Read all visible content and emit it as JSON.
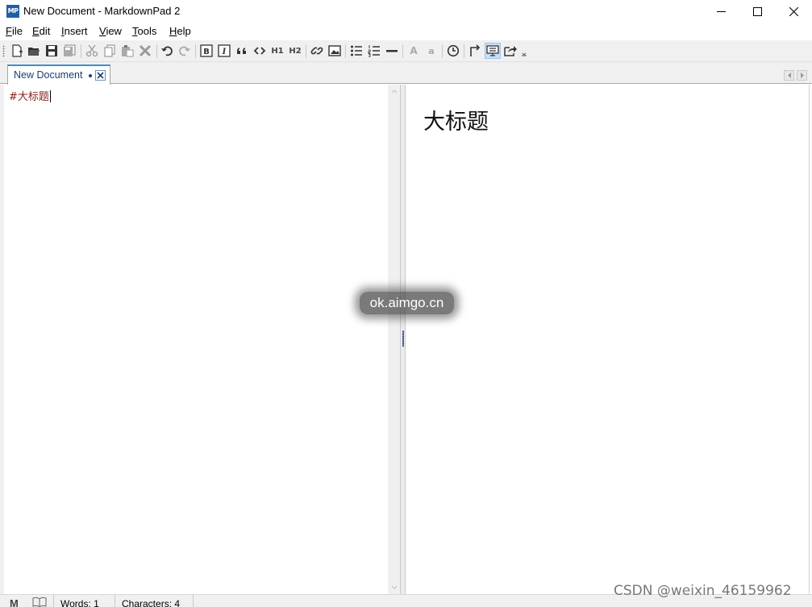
{
  "window": {
    "title": "New Document - MarkdownPad 2",
    "app_icon_text": "MP"
  },
  "menu": [
    {
      "label": "File"
    },
    {
      "label": "Edit"
    },
    {
      "label": "Insert"
    },
    {
      "label": "View"
    },
    {
      "label": "Tools"
    },
    {
      "label": "Help"
    }
  ],
  "toolbar": {
    "h1_label": "H1",
    "h2_label": "H2",
    "font_large_label": "A",
    "font_small_label": "a",
    "bold_label": "B",
    "italic_label": "I"
  },
  "tab": {
    "label": "New Document"
  },
  "editor": {
    "content": "#大标题"
  },
  "preview": {
    "heading": "大标题"
  },
  "status": {
    "markdown_icon": "M",
    "words": "Words: 1",
    "characters": "Characters: 4"
  },
  "overlays": {
    "watermark": "ok.aimgo.cn",
    "csdn": "CSDN @weixin_46159962"
  },
  "colors": {
    "tab_accent": "#3d8fd1",
    "editor_text": "#8b2222",
    "active_button": "#c7dff5"
  }
}
